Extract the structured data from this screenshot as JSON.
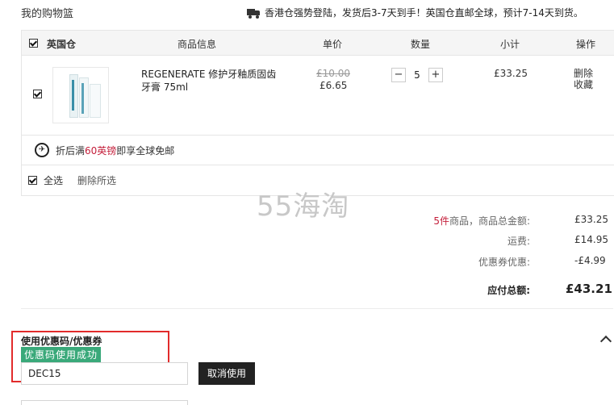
{
  "page": {
    "title": "我的购物篮"
  },
  "shipping": {
    "notice": "香港仓强势登陆，发货后3-7天到手！英国仓直邮全球，预计7-14天到货。"
  },
  "cart": {
    "headers": {
      "warehouse": "英国仓",
      "info": "商品信息",
      "price": "单价",
      "qty": "数量",
      "subtotal": "小计",
      "ops": "操作"
    },
    "item": {
      "name": "REGENERATE 修护牙釉质固齿牙膏 75ml",
      "old_price": "£10.00",
      "new_price": "£6.65",
      "quantity": "5",
      "minus": "−",
      "plus": "+",
      "subtotal": "£33.25",
      "delete": "删除",
      "favorite": "收藏"
    },
    "promo": {
      "prefix": "折后满",
      "highlight": "60英镑",
      "suffix": "即享全球免邮"
    },
    "select_all": "全选",
    "delete_selected": "删除所选"
  },
  "watermark": "55海淘",
  "summary": {
    "count_highlight": "5件",
    "count_label": "商品，商品总金额:",
    "goods_total": "£33.25",
    "shipping_label": "运费:",
    "shipping_value": "£14.95",
    "coupon_label": "优惠券优惠:",
    "coupon_value": "-£4.99",
    "payable_label": "应付总额:",
    "payable_value": "£43.21"
  },
  "coupon": {
    "title": "使用优惠码/优惠券",
    "success": "优惠码使用成功",
    "code": "DEC15",
    "cancel_label": "取消使用"
  },
  "colors": {
    "accent_red": "#c41e3a",
    "success_green": "#3aa97a",
    "highlight_box": "#e22b2b"
  }
}
